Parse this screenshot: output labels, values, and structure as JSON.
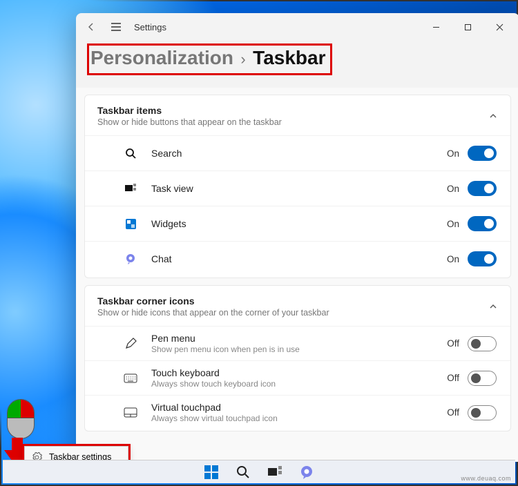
{
  "app_title": "Settings",
  "breadcrumb": {
    "parent": "Personalization",
    "current": "Taskbar"
  },
  "sections": {
    "items": {
      "title": "Taskbar items",
      "desc": "Show or hide buttons that appear on the taskbar",
      "rows": [
        {
          "label": "Search",
          "state": "On"
        },
        {
          "label": "Task view",
          "state": "On"
        },
        {
          "label": "Widgets",
          "state": "On"
        },
        {
          "label": "Chat",
          "state": "On"
        }
      ]
    },
    "corner": {
      "title": "Taskbar corner icons",
      "desc": "Show or hide icons that appear on the corner of your taskbar",
      "rows": [
        {
          "label": "Pen menu",
          "sub": "Show pen menu icon when pen is in use",
          "state": "Off"
        },
        {
          "label": "Touch keyboard",
          "sub": "Always show touch keyboard icon",
          "state": "Off"
        },
        {
          "label": "Virtual touchpad",
          "sub": "Always show virtual touchpad icon",
          "state": "Off"
        }
      ]
    }
  },
  "context_menu": {
    "label": "Taskbar settings"
  },
  "watermark": "www.deuaq.com"
}
